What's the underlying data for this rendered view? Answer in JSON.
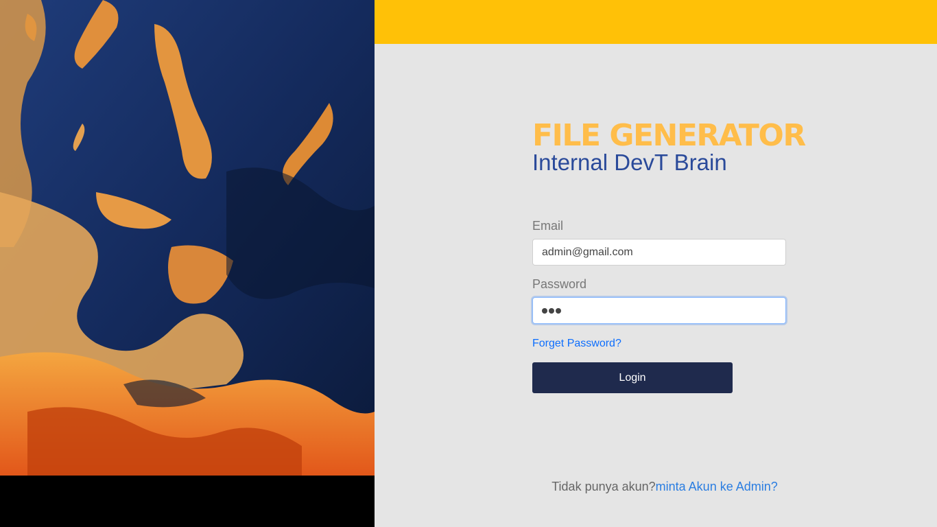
{
  "brand": {
    "title": "FILE GENERATOR",
    "subtitle": "Internal DevT Brain",
    "accent_color": "#ffc107",
    "title_color": "#ffbd4a",
    "subtitle_color": "#2a4a9a"
  },
  "form": {
    "email_label": "Email",
    "email_value": "admin@gmail.com",
    "password_label": "Password",
    "password_masked_length": 3,
    "forgot_label": "Forget Password?",
    "login_label": "Login",
    "button_color": "#1f2a4d"
  },
  "footer": {
    "prompt": "Tidak punya akun?",
    "link": "minta Akun ke Admin?"
  },
  "hero": {
    "image": "abstract-aerial-art"
  }
}
